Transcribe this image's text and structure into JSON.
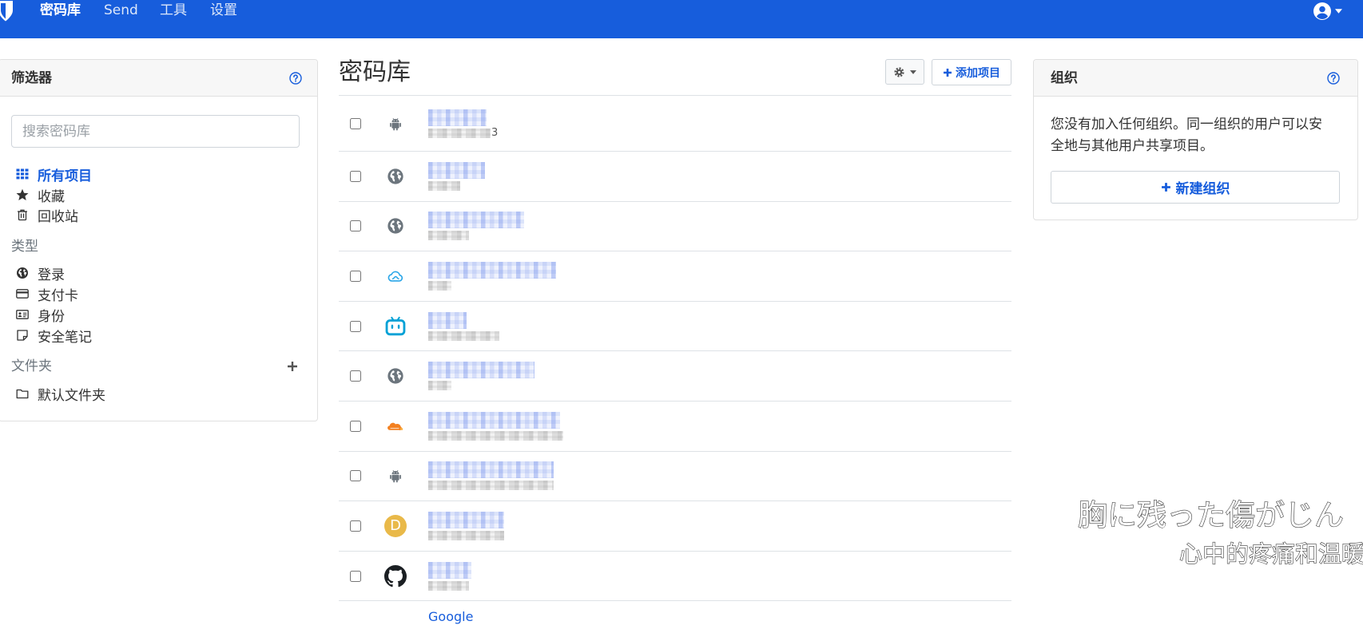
{
  "navbar": {
    "items": [
      {
        "label": "密码库",
        "active": true
      },
      {
        "label": "Send"
      },
      {
        "label": "工具"
      },
      {
        "label": "设置"
      }
    ]
  },
  "colors": {
    "brand": "#175ddc",
    "letter_avatar": "#e9b949",
    "cloudflare": "#f38020",
    "bilibili": "#00a1d6",
    "cloud_app": "#2aa6e8"
  },
  "filters": {
    "title": "筛选器",
    "search_placeholder": "搜索密码库",
    "all_items": "所有项目",
    "favorites": "收藏",
    "trash": "回收站",
    "types_heading": "类型",
    "types": [
      "登录",
      "支付卡",
      "身份",
      "安全笔记"
    ],
    "folders_heading": "文件夹",
    "folders": [
      "默认文件夹"
    ]
  },
  "vault": {
    "title": "密码库",
    "add_item": "添加项目",
    "items": [
      {
        "icon": "android-icon",
        "sub_fragment": "3"
      },
      {
        "icon": "globe-icon"
      },
      {
        "icon": "globe-icon"
      },
      {
        "icon": "cloud-icon"
      },
      {
        "icon": "bilibili-icon"
      },
      {
        "icon": "globe-icon"
      },
      {
        "icon": "cloudflare-icon"
      },
      {
        "icon": "android-icon"
      },
      {
        "icon": "letter-avatar",
        "letter": "D"
      },
      {
        "icon": "github-icon"
      }
    ],
    "partial_item_name": "Google"
  },
  "organizations": {
    "title": "组织",
    "empty_text": "您没有加入任何组织。同一组织的用户可以安全地与其他用户共享项目。",
    "new_org": "新建组织"
  },
  "subtitles": {
    "line1": "胸に残った傷がじん",
    "line2": "心中的疼痛和温暖"
  }
}
